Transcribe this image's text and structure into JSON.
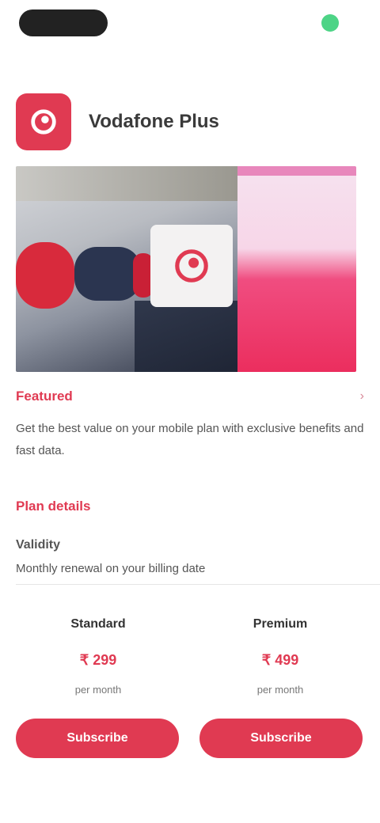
{
  "brand": {
    "name": "Vodafone Plus",
    "accent": "#e03a52"
  },
  "promo": {
    "label": "Featured",
    "more": "›"
  },
  "description": "Get the best value on your mobile plan with exclusive benefits and fast data.",
  "details": {
    "section_title": "Plan details",
    "label": "Validity",
    "value": "Monthly renewal on your billing date"
  },
  "plans": [
    {
      "name": "Standard",
      "price": "₹ 299",
      "note": "per month"
    },
    {
      "name": "Premium",
      "price": "₹ 499",
      "note": "per month"
    }
  ],
  "buttons": {
    "left": "Subscribe",
    "right": "Subscribe"
  }
}
